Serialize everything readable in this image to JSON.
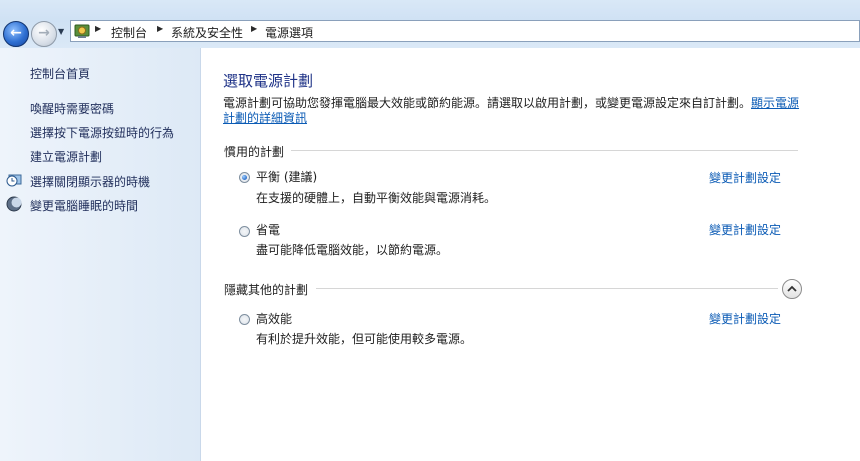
{
  "address_bar": {
    "crumbs": [
      "控制台",
      "系統及安全性",
      "電源選項"
    ]
  },
  "sidebar": {
    "home": "控制台首頁",
    "links": [
      "喚醒時需要密碼",
      "選擇按下電源按鈕時的行為",
      "建立電源計劃"
    ],
    "icon_links": [
      {
        "label": "選擇關閉顯示器的時機",
        "icon": "clock-monitor-icon"
      },
      {
        "label": "變更電腦睡眠的時間",
        "icon": "moon-sleep-icon"
      }
    ]
  },
  "main": {
    "title": "選取電源計劃",
    "description": "電源計劃可協助您發揮電腦最大效能或節約能源。請選取以啟用計劃，或變更電源設定來自訂計劃。",
    "description_link": "顯示電源計劃的詳細資訊",
    "preferred_header": "慣用的計劃",
    "hidden_header": "隱藏其他的計劃",
    "plans": [
      {
        "name": "平衡 (建議)",
        "desc": "在支援的硬體上，自動平衡效能與電源消耗。",
        "selected": true,
        "change": "變更計劃設定"
      },
      {
        "name": "省電",
        "desc": "盡可能降低電腦效能，以節約電源。",
        "selected": false,
        "change": "變更計劃設定"
      },
      {
        "name": "高效能",
        "desc": "有利於提升效能，但可能使用較多電源。",
        "selected": false,
        "change": "變更計劃設定"
      }
    ]
  },
  "colors": {
    "link": "#0b5bb5",
    "title": "#1e3287",
    "sidebar_bg": "#dde9f6"
  }
}
